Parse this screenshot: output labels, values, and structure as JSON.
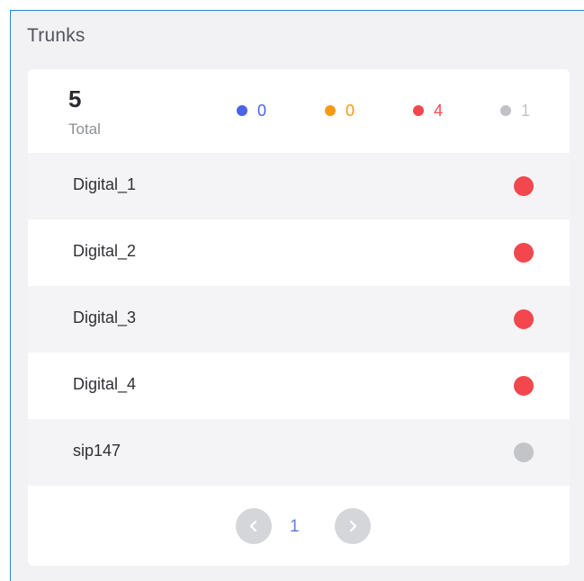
{
  "panel": {
    "title": "Trunks"
  },
  "summary": {
    "total_count": "5",
    "total_label": "Total",
    "stats": [
      {
        "name": "stat-blue",
        "value": "0",
        "color": "#4a63e8"
      },
      {
        "name": "stat-orange",
        "value": "0",
        "color": "#f79a12"
      },
      {
        "name": "stat-red",
        "value": "4",
        "color": "#f2484d"
      },
      {
        "name": "stat-gray",
        "value": "1",
        "color": "#c0c2c7"
      }
    ]
  },
  "trunks": [
    {
      "name": "Digital_1",
      "status_color": "#f2484d"
    },
    {
      "name": "Digital_2",
      "status_color": "#f2484d"
    },
    {
      "name": "Digital_3",
      "status_color": "#f2484d"
    },
    {
      "name": "Digital_4",
      "status_color": "#f2484d"
    },
    {
      "name": "sip147",
      "status_color": "#c3c4c8"
    }
  ],
  "pagination": {
    "current_page": "1"
  }
}
